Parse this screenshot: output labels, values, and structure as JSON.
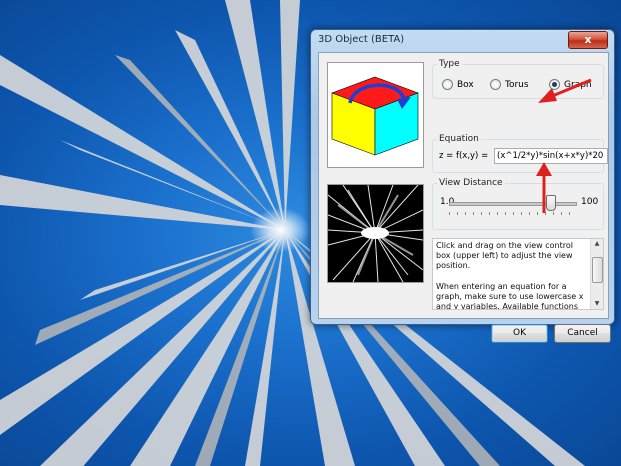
{
  "dialog": {
    "title": "3D Object (BETA)",
    "close_label": "x",
    "type_group": {
      "label": "Type",
      "options": [
        {
          "label": "Box",
          "checked": false
        },
        {
          "label": "Torus",
          "checked": false
        },
        {
          "label": "Graph",
          "checked": true
        }
      ]
    },
    "equation": {
      "group_label": "Equation",
      "prefix": "z = f(x,y) =",
      "value": "(x^1/2*y)*sin(x+x*y)*20"
    },
    "view_distance": {
      "group_label": "View Distance",
      "min_label": "1.0",
      "max_label": "100",
      "level_fraction": 0.8
    },
    "help": {
      "paragraph1": "Click and drag on the view control box (upper left) to adjust the view position.",
      "paragraph2": "When entering an equation for a graph, make sure to use lowercase x and y variables. Available functions include sin,"
    },
    "ok_label": "OK",
    "cancel_label": "Cancel"
  },
  "colors": {
    "desktop_blue": "#1a6fcb",
    "cube_top": "#ff1a1a",
    "cube_left": "#ffff00",
    "cube_right": "#00ffff",
    "rotation_arrow": "#1c3fd6",
    "annotation_arrow": "#e02020"
  },
  "icons": [
    "close-icon",
    "rotate-arrow-icon",
    "scroll-up-icon",
    "scroll-down-icon"
  ]
}
